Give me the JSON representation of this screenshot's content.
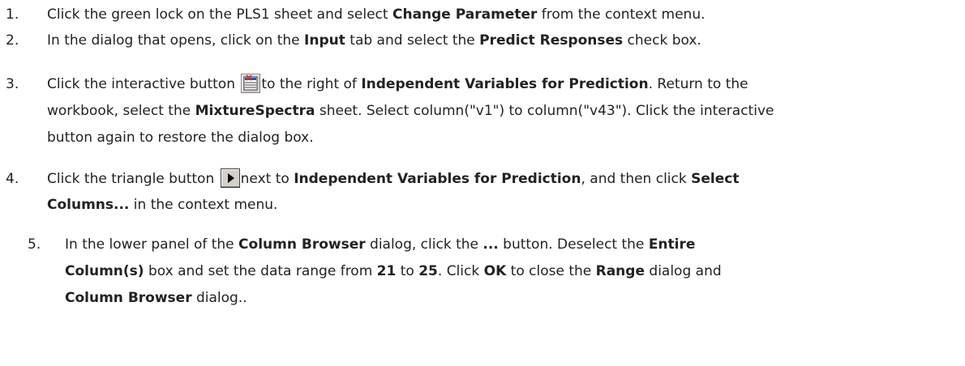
{
  "steps": [
    {
      "number": "1.",
      "lines": [
        [
          {
            "t": "Click the green lock on the PLS1 sheet and select ",
            "b": false
          },
          {
            "t": "Change Parameter",
            "b": true
          },
          {
            "t": " from the context menu.",
            "b": false
          }
        ]
      ]
    },
    {
      "number": "2.",
      "lines": [
        [
          {
            "t": "In the dialog that opens, click on the ",
            "b": false
          },
          {
            "t": "Input",
            "b": true
          },
          {
            "t": " tab and select the ",
            "b": false
          },
          {
            "t": "Predict Responses",
            "b": true
          },
          {
            "t": " check box.",
            "b": false
          }
        ]
      ]
    },
    {
      "number": "3.",
      "lines": [
        [
          {
            "t": "Click the interactive button ",
            "b": false
          },
          {
            "icon": "interactive-select-icon"
          },
          {
            "t": "to the right of ",
            "b": false
          },
          {
            "t": "Independent Variables for Prediction",
            "b": true
          },
          {
            "t": ". Return to the",
            "b": false
          }
        ],
        [
          {
            "t": "workbook, select the ",
            "b": false
          },
          {
            "t": "MixtureSpectra",
            "b": true
          },
          {
            "t": " sheet. Select column(\"v1\") to column(\"v43\"). Click the interactive",
            "b": false
          }
        ],
        [
          {
            "t": "button again to restore the dialog box.",
            "b": false
          }
        ]
      ]
    },
    {
      "number": "4.",
      "lines": [
        [
          {
            "t": "Click the triangle button ",
            "b": false
          },
          {
            "icon": "triangle-right-icon"
          },
          {
            "t": "next to ",
            "b": false
          },
          {
            "t": "Independent Variables for Prediction",
            "b": true
          },
          {
            "t": ", and then click ",
            "b": false
          },
          {
            "t": "Select",
            "b": true
          }
        ],
        [
          {
            "t": "Columns...",
            "b": true
          },
          {
            "t": " in the context menu.",
            "b": false
          }
        ]
      ]
    },
    {
      "number": "5.",
      "lines": [
        [
          {
            "t": "In the lower panel of the ",
            "b": false
          },
          {
            "t": "Column Browser",
            "b": true
          },
          {
            "t": " dialog, click the ",
            "b": false
          },
          {
            "t": "...",
            "b": true
          },
          {
            "t": " button. Deselect the ",
            "b": false
          },
          {
            "t": "Entire",
            "b": true
          }
        ],
        [
          {
            "t": "Column(s)",
            "b": true
          },
          {
            "t": " box and set the data range from ",
            "b": false
          },
          {
            "t": "21",
            "b": true
          },
          {
            "t": " to ",
            "b": false
          },
          {
            "t": "25",
            "b": true
          },
          {
            "t": ". Click ",
            "b": false
          },
          {
            "t": "OK",
            "b": true
          },
          {
            "t": " to close the ",
            "b": false
          },
          {
            "t": "Range",
            "b": true
          },
          {
            "t": " dialog and",
            "b": false
          }
        ],
        [
          {
            "t": "Column Browser",
            "b": true
          },
          {
            "t": " dialog..",
            "b": false
          }
        ]
      ]
    }
  ]
}
